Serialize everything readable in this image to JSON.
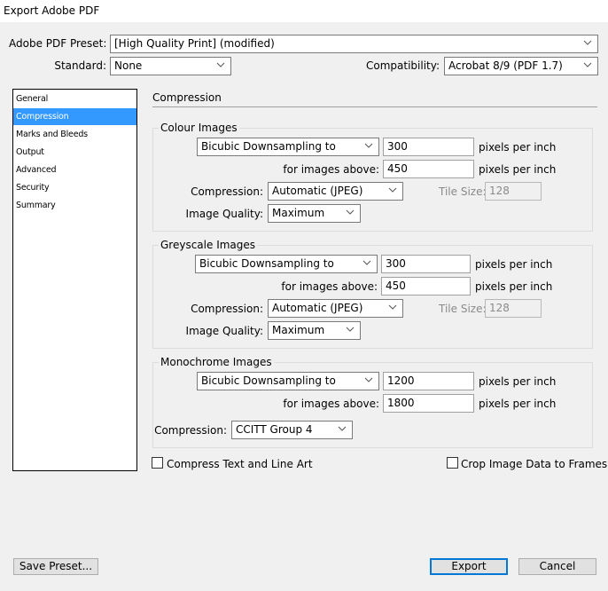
{
  "window": {
    "title": "Export Adobe PDF"
  },
  "header": {
    "preset_label": "Adobe PDF Preset:",
    "preset_value": "[High Quality Print] (modified)",
    "standard_label": "Standard:",
    "standard_value": "None",
    "compatibility_label": "Compatibility:",
    "compatibility_value": "Acrobat 8/9 (PDF 1.7)"
  },
  "sidebar": {
    "selected": "Compression",
    "items": [
      {
        "label": "General"
      },
      {
        "label": "Compression"
      },
      {
        "label": "Marks and Bleeds"
      },
      {
        "label": "Output"
      },
      {
        "label": "Advanced"
      },
      {
        "label": "Security"
      },
      {
        "label": "Summary"
      }
    ]
  },
  "main": {
    "section_title": "Compression",
    "colour": {
      "title": "Colour Images",
      "sampling": "Bicubic Downsampling to",
      "ppi": "300",
      "ppi_unit": "pixels per inch",
      "above_label": "for images above:",
      "above_value": "450",
      "above_unit": "pixels per inch",
      "compression_label": "Compression:",
      "compression_value": "Automatic (JPEG)",
      "tile_label": "Tile Size:",
      "tile_value": "128",
      "quality_label": "Image Quality:",
      "quality_value": "Maximum"
    },
    "grey": {
      "title": "Greyscale Images",
      "sampling": "Bicubic Downsampling to",
      "ppi": "300",
      "ppi_unit": "pixels per inch",
      "above_label": "for images above:",
      "above_value": "450",
      "above_unit": "pixels per inch",
      "compression_label": "Compression:",
      "compression_value": "Automatic (JPEG)",
      "tile_label": "Tile Size:",
      "tile_value": "128",
      "quality_label": "Image Quality:",
      "quality_value": "Maximum"
    },
    "mono": {
      "title": "Monochrome Images",
      "sampling": "Bicubic Downsampling to",
      "ppi": "1200",
      "ppi_unit": "pixels per inch",
      "above_label": "for images above:",
      "above_value": "1800",
      "above_unit": "pixels per inch",
      "compression_label": "Compression:",
      "compression_value": "CCITT Group 4"
    },
    "compress_text_label": "Compress Text and Line Art",
    "compress_text_checked": false,
    "crop_label": "Crop Image Data to Frames",
    "crop_checked": false
  },
  "footer": {
    "save_preset": "Save Preset...",
    "export": "Export",
    "cancel": "Cancel"
  }
}
